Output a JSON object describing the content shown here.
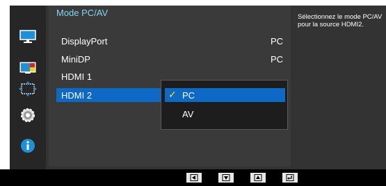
{
  "menu": {
    "title": "Mode PC/AV",
    "rows": [
      {
        "label": "DisplayPort",
        "value": "PC"
      },
      {
        "label": "MiniDP",
        "value": "PC"
      },
      {
        "label": "HDMI 1",
        "value": ""
      },
      {
        "label": "HDMI 2",
        "value": ""
      }
    ]
  },
  "dropdown": {
    "options": [
      {
        "label": "PC",
        "selected": true
      },
      {
        "label": "AV",
        "selected": false
      }
    ],
    "check_mark": "✓"
  },
  "help": {
    "text": "Sélectionnez le mode PC/AV pour la source HDMI2."
  },
  "sidebar": {
    "icons": [
      "monitor-icon",
      "color-icon",
      "size-position-icon",
      "setup-gear-icon",
      "info-icon"
    ]
  },
  "nav": {
    "buttons": [
      "left-arrow-icon",
      "down-arrow-icon",
      "up-arrow-icon",
      "enter-icon"
    ]
  },
  "colors": {
    "accent_blue": "#0d69c5",
    "title_cyan": "#7fd8f4",
    "check_yellow": "#ffe000"
  }
}
